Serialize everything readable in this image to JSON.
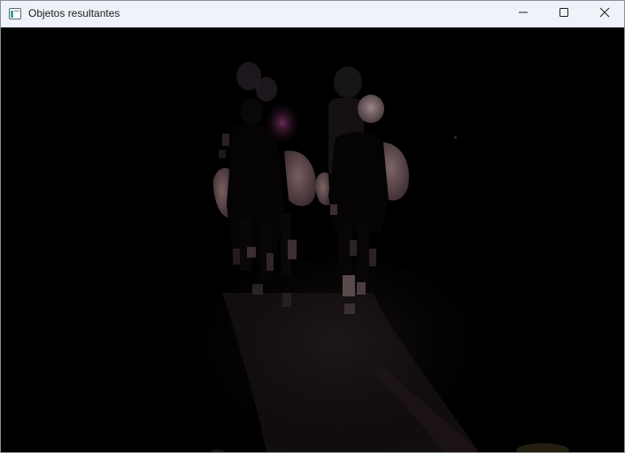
{
  "window": {
    "title": "Objetos resultantes",
    "app_icon": "window-app-icon",
    "controls": {
      "minimize_icon": "minimize-icon",
      "maximize_icon": "maximize-icon",
      "close_icon": "close-icon"
    }
  },
  "image": {
    "description_icon": "segmented-result-image",
    "background_color": "#000000"
  },
  "colors": {
    "titlebar": "#eef3f9",
    "titlebar_text": "#1b1b1b",
    "close_hover": "#c42b1c"
  }
}
